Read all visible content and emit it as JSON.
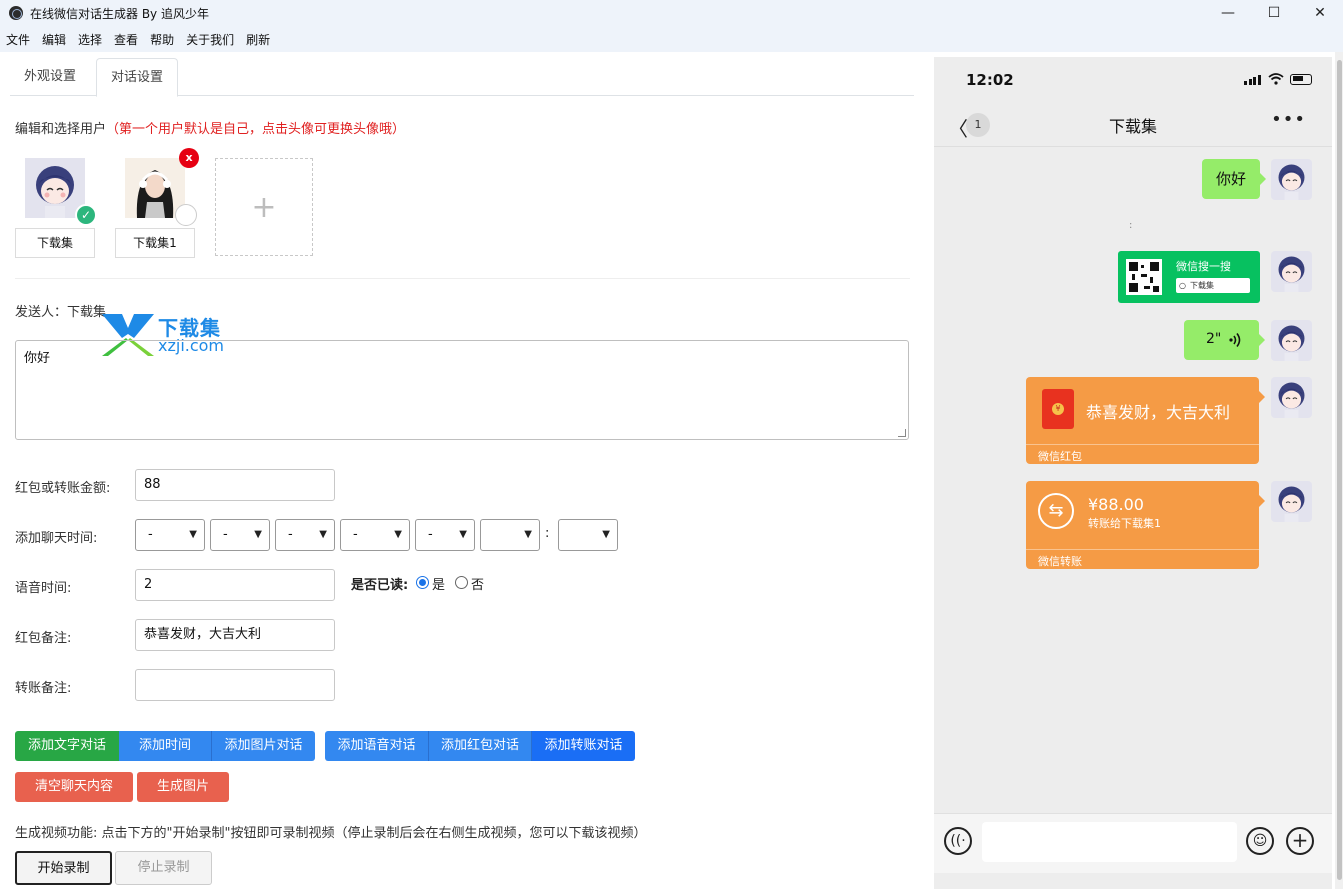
{
  "window": {
    "title": "在线微信对话生成器 By 追风少年"
  },
  "menu": [
    "文件",
    "编辑",
    "选择",
    "查看",
    "帮助",
    "关于我们",
    "刷新"
  ],
  "tabs": [
    {
      "label": "外观设置",
      "active": false
    },
    {
      "label": "对话设置",
      "active": true
    }
  ],
  "users_section": {
    "heading": "编辑和选择用户",
    "note": "（第一个用户默认是自己，点击头像可更换头像哦）",
    "users": [
      {
        "name": "下载集",
        "selected": true
      },
      {
        "name": "下载集1",
        "selected": false
      }
    ],
    "delete_label": "x",
    "add_label": "+"
  },
  "sender": {
    "label": "发送人：",
    "name": "下载集"
  },
  "watermark": {
    "cn": "下载集",
    "en": "xzji.com"
  },
  "message_text": "你好",
  "form": {
    "amount_label": "红包或转账金额:",
    "amount_value": "88",
    "time_label": "添加聊天时间:",
    "time_selects": [
      "-",
      "-",
      "-",
      "-",
      "-",
      "",
      ""
    ],
    "time_colon": ":",
    "voice_label": "语音时间:",
    "voice_value": "2",
    "read_label": "是否已读:",
    "read_yes": "是",
    "read_no": "否",
    "read_selected": "是",
    "redpacket_note_label": "红包备注:",
    "redpacket_note_value": "恭喜发财，大吉大利",
    "transfer_note_label": "转账备注:",
    "transfer_note_value": ""
  },
  "buttons": {
    "add_text": "添加文字对话",
    "add_time": "添加时间",
    "add_image": "添加图片对话",
    "add_voice": "添加语音对话",
    "add_redpacket": "添加红包对话",
    "add_transfer": "添加转账对话",
    "clear": "清空聊天内容",
    "generate": "生成图片"
  },
  "video": {
    "note": "生成视频功能: 点击下方的\"开始录制\"按钮即可录制视频（停止录制后会在右侧生成视频，您可以下载该视频）",
    "start": "开始录制",
    "stop": "停止录制"
  },
  "phone": {
    "time": "12:02",
    "unread_count": "1",
    "chat_title": "下载集",
    "messages": {
      "text": "你好",
      "time_marker": ":",
      "card_brand": "微信搜一搜",
      "card_search": "下载集",
      "voice_duration": "2\"",
      "redpacket_text": "恭喜发财，大吉大利",
      "redpacket_footer": "微信红包",
      "transfer_amount": "¥88.00",
      "transfer_to": "转账给下载集1",
      "transfer_footer": "微信转账"
    }
  },
  "colors": {
    "bubble_green": "#95ec69",
    "wechat_green": "#07c160",
    "orange": "#f59b45",
    "button_green": "#28a745",
    "button_blue": "#3388f0",
    "button_red": "#e8614e"
  }
}
